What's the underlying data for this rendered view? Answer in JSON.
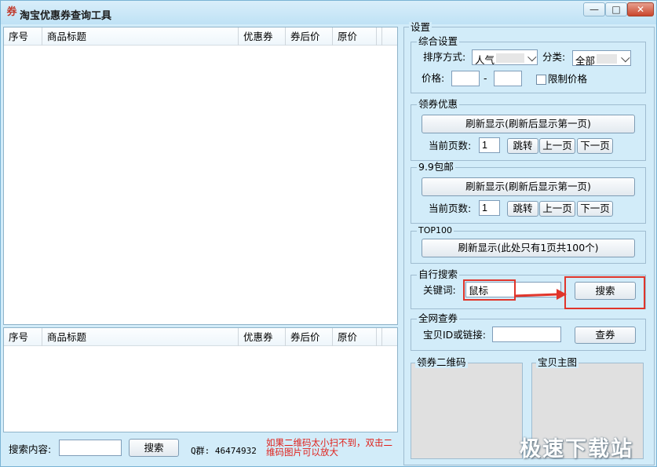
{
  "window": {
    "title": "淘宝优惠券查询工具",
    "app_icon_char": "券",
    "controls": {
      "minimize": "—",
      "maximize": "□",
      "close": "✕"
    }
  },
  "list_top": {
    "columns": [
      "序号",
      "商品标题",
      "优惠券",
      "券后价",
      "原价"
    ],
    "rows": []
  },
  "list_bottom": {
    "columns": [
      "序号",
      "商品标题",
      "优惠券",
      "券后价",
      "原价"
    ],
    "rows": []
  },
  "bottom_bar": {
    "search_label": "搜索内容:",
    "search_value": "",
    "search_button": "搜索",
    "qq_group": "Q群: 46474932",
    "qr_hint": "如果二维码太小扫不到，双击二维码图片可以放大"
  },
  "settings": {
    "title": "设置",
    "general": {
      "title": "综合设置",
      "sort_label": "排序方式:",
      "sort_value": "人气",
      "category_label": "分类:",
      "category_value": "全部",
      "price_label": "价格:",
      "price_min": "",
      "price_max": "",
      "price_dash": "-",
      "limit_price_label": "限制价格",
      "limit_price_checked": false
    },
    "coupons": {
      "title": "领券优惠",
      "refresh_button": "刷新显示(刷新后显示第一页)",
      "page_label": "当前页数:",
      "page_value": "1",
      "jump_button": "跳转",
      "prev_button": "上一页",
      "next_button": "下一页"
    },
    "free_shipping": {
      "title": "9.9包邮",
      "refresh_button": "刷新显示(刷新后显示第一页)",
      "page_label": "当前页数:",
      "page_value": "1",
      "jump_button": "跳转",
      "prev_button": "上一页",
      "next_button": "下一页"
    },
    "top100": {
      "title": "TOP100",
      "refresh_button": "刷新显示(此处只有1页共100个)"
    },
    "custom_search": {
      "title": "自行搜索",
      "keyword_label": "关键词:",
      "keyword_value": "鼠标",
      "search_button": "搜索"
    },
    "web_query": {
      "title": "全网查券",
      "id_label": "宝贝ID或链接:",
      "id_value": "",
      "query_button": "查券"
    },
    "qr_coupon_title": "领券二维码",
    "main_image_title": "宝贝主图"
  },
  "annotation_color": "#e0352b",
  "watermark": "极速下载站"
}
